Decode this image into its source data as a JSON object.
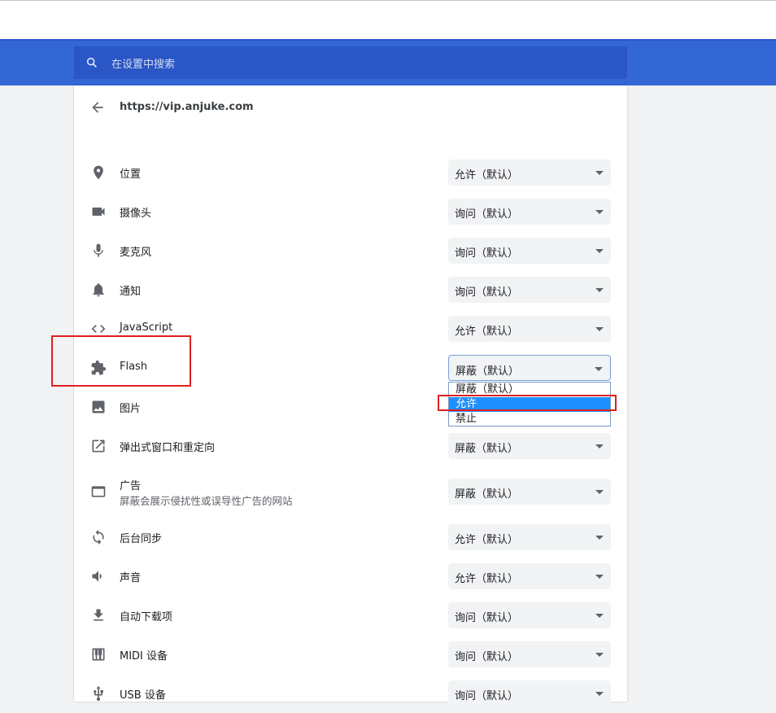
{
  "search": {
    "placeholder": "在设置中搜索",
    "icon": "search-icon"
  },
  "header": {
    "url": "https://vip.anjuke.com"
  },
  "rows": [
    {
      "label": "位置",
      "value": "允许（默认）",
      "icon": "location-pin-icon"
    },
    {
      "label": "摄像头",
      "value": "询问（默认）",
      "icon": "camera-icon"
    },
    {
      "label": "麦克风",
      "value": "询问（默认）",
      "icon": "microphone-icon"
    },
    {
      "label": "通知",
      "value": "询问（默认）",
      "icon": "bell-icon"
    },
    {
      "label": "JavaScript",
      "value": "允许（默认）",
      "icon": "code-icon"
    },
    {
      "label": "Flash",
      "value": "屏蔽（默认）",
      "icon": "puzzle-icon"
    },
    {
      "label": "图片",
      "value": "",
      "icon": "image-icon"
    },
    {
      "label": "弹出式窗口和重定向",
      "value": "屏蔽（默认）",
      "icon": "open-in-new-icon"
    },
    {
      "label": "广告",
      "sublabel": "屏蔽会展示侵扰性或误导性广告的网站",
      "value": "屏蔽（默认）",
      "icon": "ad-window-icon"
    },
    {
      "label": "后台同步",
      "value": "允许（默认）",
      "icon": "sync-icon"
    },
    {
      "label": "声音",
      "value": "允许（默认）",
      "icon": "speaker-icon"
    },
    {
      "label": "自动下载项",
      "value": "询问（默认）",
      "icon": "download-icon"
    },
    {
      "label": "MIDI 设备",
      "value": "询问（默认）",
      "icon": "piano-icon"
    },
    {
      "label": "USB 设备",
      "value": "询问（默认）",
      "icon": "usb-icon"
    }
  ],
  "flash_dropdown": {
    "options": [
      "屏蔽（默认）",
      "允许",
      "禁止"
    ],
    "highlighted": "允许"
  },
  "colors": {
    "accent": "#3367d6",
    "highlight": "#1e90ff",
    "annotation": "#e02020"
  }
}
